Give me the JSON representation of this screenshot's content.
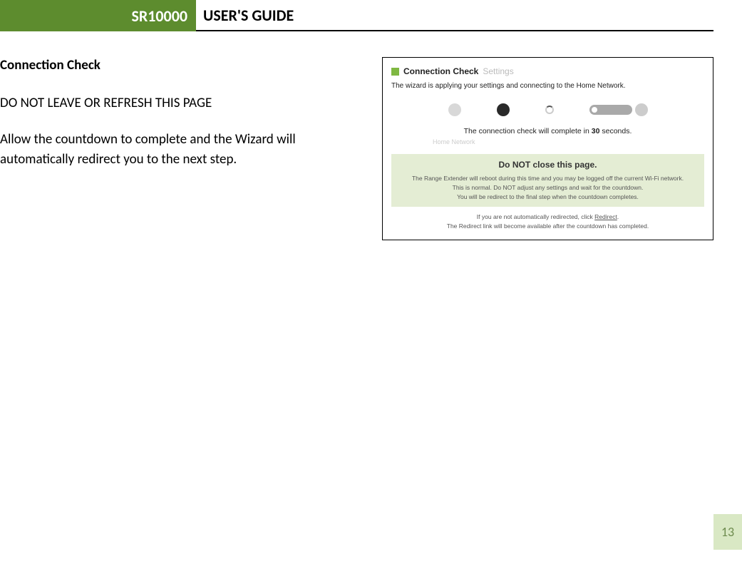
{
  "header": {
    "product": "SR10000",
    "title": "USER'S GUIDE"
  },
  "section_title": "Connection Check",
  "warning": "DO NOT LEAVE OR REFRESH THIS PAGE",
  "body": "Allow the countdown to complete and the Wizard will automatically redirect you to the next step.",
  "screenshot": {
    "panel_title": "Connection Check",
    "panel_title_dim": "Settings",
    "applying": "The wizard is applying your settings and connecting to the Home Network.",
    "countdown_prefix": "The connection check will complete in ",
    "countdown_seconds": "30",
    "countdown_suffix": " seconds.",
    "dim_label": "Home Network",
    "notice_title": "Do NOT close this page.",
    "notice_line1": "The Range Extender will reboot during this time and you may be logged off the current Wi-Fi network.",
    "notice_line2": "This is normal. Do NOT adjust any settings and wait for the countdown.",
    "notice_line3": "You will be redirect to the final step when the countdown completes.",
    "redirect_prefix": "If you are not automatically redirected, click ",
    "redirect_link": "Redirect",
    "redirect_suffix": ".",
    "redirect_note": "The Redirect link will become available after the countdown has completed."
  },
  "page_number": "13"
}
